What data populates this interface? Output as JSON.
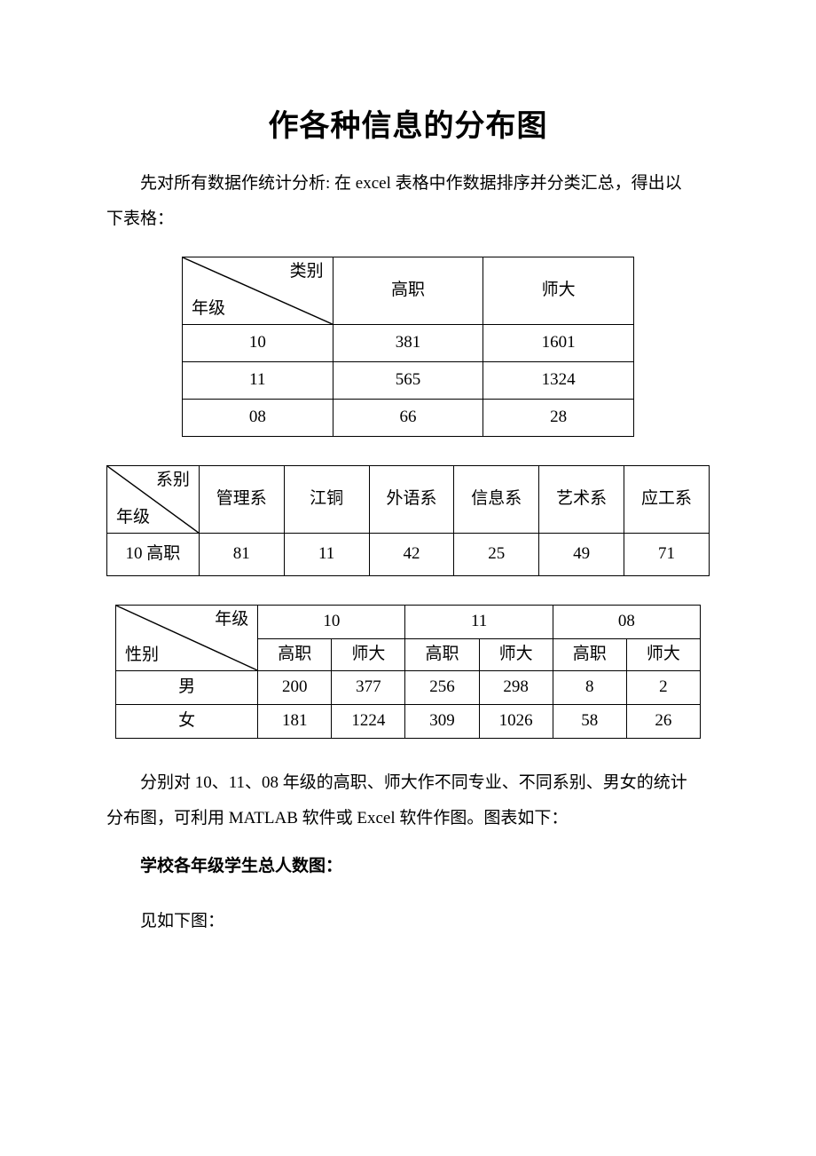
{
  "title": "作各种信息的分布图",
  "intro_line1": "先对所有数据作统计分析: 在 excel 表格中作数据排序并分类汇总，得出以",
  "intro_line2": "下表格：",
  "table1": {
    "diag_top": "类别",
    "diag_bottom": "年级",
    "col_headers": [
      "高职",
      "师大"
    ],
    "rows": [
      {
        "label": "10",
        "cells": [
          "381",
          "1601"
        ]
      },
      {
        "label": "11",
        "cells": [
          "565",
          "1324"
        ]
      },
      {
        "label": "08",
        "cells": [
          "66",
          "28"
        ]
      }
    ]
  },
  "table2": {
    "diag_top": "系别",
    "diag_bottom": "年级",
    "col_headers": [
      "管理系",
      "江铜",
      "外语系",
      "信息系",
      "艺术系",
      "应工系"
    ],
    "row": {
      "label": "10 高职",
      "cells": [
        "81",
        "11",
        "42",
        "25",
        "49",
        "71"
      ]
    }
  },
  "table3": {
    "diag_top": "年级",
    "diag_bottom": "性别",
    "group_headers": [
      "10",
      "11",
      "08"
    ],
    "sub_headers": [
      "高职",
      "师大",
      "高职",
      "师大",
      "高职",
      "师大"
    ],
    "rows": [
      {
        "label": "男",
        "cells": [
          "200",
          "377",
          "256",
          "298",
          "8",
          "2"
        ]
      },
      {
        "label": "女",
        "cells": [
          "181",
          "1224",
          "309",
          "1026",
          "58",
          "26"
        ]
      }
    ]
  },
  "mid_para1": "分别对 10、11、08 年级的高职、师大作不同专业、不同系别、男女的统计",
  "mid_para2_prefix": "分布图，可利用 MATLAB 软件或 Excel 软件作图。图表如下：",
  "section_heading": "学校各年级学生总人数图：",
  "see_below": "见如下图："
}
